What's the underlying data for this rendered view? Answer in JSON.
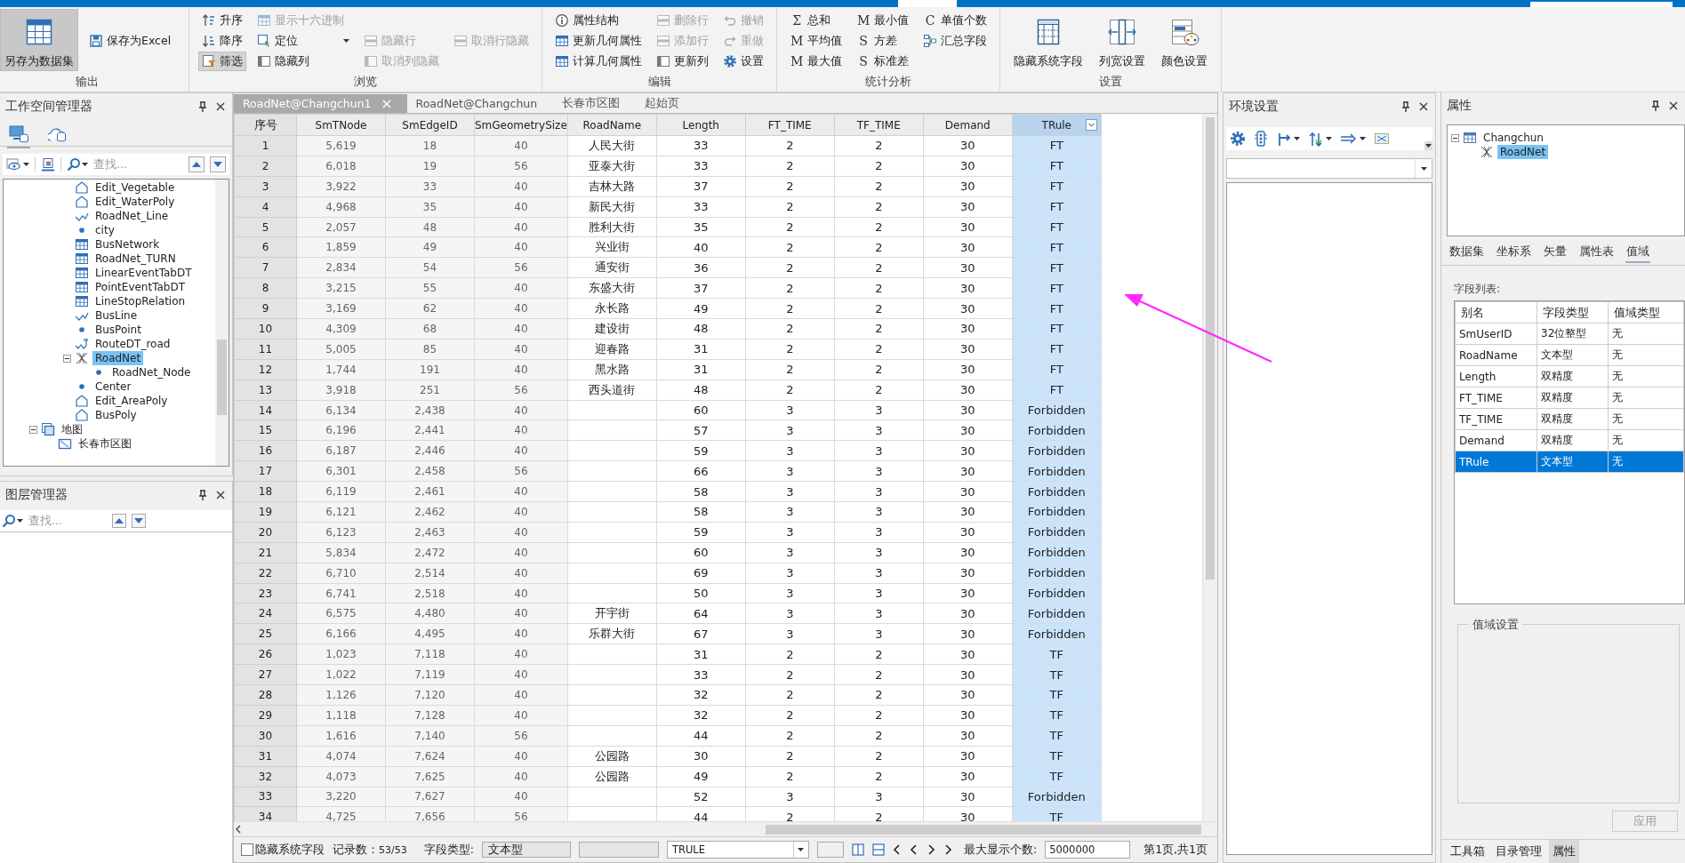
{
  "ribbon": {
    "groups": [
      {
        "label": "输出",
        "large": [
          {
            "label": "另存为数据集",
            "selected": true,
            "disabled": false
          }
        ],
        "rows": [
          [
            {
              "label": "保存为Excel",
              "kind": "plain",
              "selected": false,
              "disabled": false
            }
          ]
        ]
      },
      {
        "label": "浏览",
        "rows": [
          [
            {
              "label": "升序",
              "kind": "plain",
              "selected": false,
              "disabled": false
            },
            {
              "label": "显示十六进制",
              "kind": "plain",
              "selected": false,
              "disabled": true
            }
          ],
          [
            {
              "label": "降序",
              "kind": "plain",
              "selected": false,
              "disabled": false
            },
            {
              "label": "定位",
              "kind": "dropdown",
              "selected": false,
              "disabled": false
            },
            {
              "label": "隐藏行",
              "kind": "plain",
              "selected": false,
              "disabled": true
            },
            {
              "label": "取消行隐藏",
              "kind": "plain",
              "selected": false,
              "disabled": true
            }
          ],
          [
            {
              "label": "筛选",
              "kind": "plain",
              "selected": true,
              "disabled": false
            },
            {
              "label": "隐藏列",
              "kind": "plain",
              "selected": false,
              "disabled": false
            },
            {
              "label": "取消列隐藏",
              "kind": "plain",
              "selected": false,
              "disabled": true
            }
          ]
        ]
      },
      {
        "label": "编辑",
        "rows": [
          [
            {
              "label": "属性结构",
              "kind": "plain",
              "selected": false,
              "disabled": false
            },
            {
              "label": "删除行",
              "kind": "plain",
              "selected": false,
              "disabled": true
            },
            {
              "label": "撤销",
              "kind": "plain",
              "selected": false,
              "disabled": true
            }
          ],
          [
            {
              "label": "更新几何属性",
              "kind": "plain",
              "selected": false,
              "disabled": false
            },
            {
              "label": "添加行",
              "kind": "plain",
              "selected": false,
              "disabled": true
            },
            {
              "label": "重做",
              "kind": "plain",
              "selected": false,
              "disabled": true
            }
          ],
          [
            {
              "label": "计算几何属性",
              "kind": "plain",
              "selected": false,
              "disabled": false
            },
            {
              "label": "更新列",
              "kind": "plain",
              "selected": false,
              "disabled": false
            },
            {
              "label": "设置",
              "kind": "plain",
              "selected": false,
              "disabled": false
            }
          ]
        ]
      },
      {
        "label": "统计分析",
        "rows": [
          [
            {
              "label": "总和",
              "kind": "glyph",
              "glyph": "Σ",
              "selected": false,
              "disabled": false
            },
            {
              "label": "最小值",
              "kind": "glyph",
              "glyph": "M",
              "selected": false,
              "disabled": false
            },
            {
              "label": "单值个数",
              "kind": "glyph",
              "glyph": "C",
              "selected": false,
              "disabled": false
            }
          ],
          [
            {
              "label": "平均值",
              "kind": "glyph",
              "glyph": "M",
              "selected": false,
              "disabled": false
            },
            {
              "label": "方差",
              "kind": "glyph",
              "glyph": "S",
              "selected": false,
              "disabled": false
            },
            {
              "label": "汇总字段",
              "kind": "plain",
              "selected": false,
              "disabled": false
            }
          ],
          [
            {
              "label": "最大值",
              "kind": "glyph",
              "glyph": "M",
              "selected": false,
              "disabled": false
            },
            {
              "label": "标准差",
              "kind": "glyph",
              "glyph": "S",
              "selected": false,
              "disabled": false
            }
          ]
        ]
      },
      {
        "label": "设置",
        "large": [
          {
            "label": "隐藏系统字段",
            "selected": false,
            "disabled": false
          },
          {
            "label": "列宽设置",
            "selected": false,
            "disabled": false
          },
          {
            "label": "颜色设置",
            "selected": false,
            "disabled": false
          }
        ]
      }
    ]
  },
  "workspace": {
    "title": "工作空间管理器",
    "tabs": [
      {
        "selected": true
      },
      {
        "selected": false
      }
    ],
    "search_placeholder": "查找...",
    "datasets": [
      {
        "label": "Edit_Vegetable",
        "kind": "region",
        "selected": false
      },
      {
        "label": "Edit_WaterPoly",
        "kind": "region",
        "selected": false
      },
      {
        "label": "RoadNet_Line",
        "kind": "line",
        "selected": false
      },
      {
        "label": "city",
        "kind": "point",
        "selected": false
      },
      {
        "label": "BusNetwork",
        "kind": "tabular",
        "selected": false
      },
      {
        "label": "RoadNet_TURN",
        "kind": "tabular",
        "selected": false
      },
      {
        "label": "LinearEventTabDT",
        "kind": "tabular",
        "selected": false
      },
      {
        "label": "PointEventTabDT",
        "kind": "tabular",
        "selected": false
      },
      {
        "label": "LineStopRelation",
        "kind": "tabular",
        "selected": false
      },
      {
        "label": "BusLine",
        "kind": "line",
        "selected": false
      },
      {
        "label": "BusPoint",
        "kind": "point",
        "selected": false
      },
      {
        "label": "RouteDT_road",
        "kind": "route",
        "selected": false
      },
      {
        "label": "RoadNet",
        "kind": "network",
        "selected": true,
        "expanded": true,
        "children": [
          {
            "label": "RoadNet_Node",
            "kind": "point",
            "selected": false
          }
        ]
      },
      {
        "label": "Center",
        "kind": "point",
        "selected": false
      },
      {
        "label": "Edit_AreaPoly",
        "kind": "region",
        "selected": false
      },
      {
        "label": "BusPoly",
        "kind": "region",
        "selected": false
      }
    ],
    "maps": [
      {
        "label": "地图",
        "kind": "maps",
        "selected": false,
        "expanded": true,
        "children": [
          {
            "label": "长春市区图",
            "kind": "map",
            "selected": false
          }
        ]
      }
    ]
  },
  "layers": {
    "title": "图层管理器",
    "search_placeholder": "查找..."
  },
  "document": {
    "tabs": [
      {
        "label": "RoadNet@Changchun1",
        "selected": true,
        "closable": true
      },
      {
        "label": "RoadNet@Changchun",
        "selected": false,
        "closable": false
      },
      {
        "label": "长春市区图",
        "selected": false,
        "closable": false
      },
      {
        "label": "起始页",
        "selected": false,
        "closable": false
      }
    ],
    "table": {
      "columns": [
        {
          "label": "序号",
          "kind": "index",
          "selected": false
        },
        {
          "label": "SmTNode",
          "kind": "system",
          "selected": false
        },
        {
          "label": "SmEdgeID",
          "kind": "system",
          "selected": false
        },
        {
          "label": "SmGeometrySize",
          "kind": "system",
          "selected": false
        },
        {
          "label": "RoadName",
          "kind": "user",
          "selected": false
        },
        {
          "label": "Length",
          "kind": "user",
          "selected": false
        },
        {
          "label": "FT_TIME",
          "kind": "user",
          "selected": false
        },
        {
          "label": "TF_TIME",
          "kind": "user",
          "selected": false
        },
        {
          "label": "Demand",
          "kind": "user",
          "selected": false
        },
        {
          "label": "TRule",
          "kind": "user",
          "selected": true
        }
      ],
      "rows": [
        [
          "1",
          "5,619",
          "18",
          "40",
          "人民大街",
          "33",
          "2",
          "2",
          "30",
          "FT"
        ],
        [
          "2",
          "6,018",
          "19",
          "56",
          "亚泰大街",
          "33",
          "2",
          "2",
          "30",
          "FT"
        ],
        [
          "3",
          "3,922",
          "33",
          "40",
          "吉林大路",
          "37",
          "2",
          "2",
          "30",
          "FT"
        ],
        [
          "4",
          "4,968",
          "35",
          "40",
          "新民大街",
          "33",
          "2",
          "2",
          "30",
          "FT"
        ],
        [
          "5",
          "2,057",
          "48",
          "40",
          "胜利大街",
          "35",
          "2",
          "2",
          "30",
          "FT"
        ],
        [
          "6",
          "1,859",
          "49",
          "40",
          "兴业街",
          "40",
          "2",
          "2",
          "30",
          "FT"
        ],
        [
          "7",
          "2,834",
          "54",
          "56",
          "通安街",
          "36",
          "2",
          "2",
          "30",
          "FT"
        ],
        [
          "8",
          "3,215",
          "55",
          "40",
          "东盛大街",
          "37",
          "2",
          "2",
          "30",
          "FT"
        ],
        [
          "9",
          "3,169",
          "62",
          "40",
          "永长路",
          "49",
          "2",
          "2",
          "30",
          "FT"
        ],
        [
          "10",
          "4,309",
          "68",
          "40",
          "建设街",
          "48",
          "2",
          "2",
          "30",
          "FT"
        ],
        [
          "11",
          "5,005",
          "85",
          "40",
          "迎春路",
          "31",
          "2",
          "2",
          "30",
          "FT"
        ],
        [
          "12",
          "1,744",
          "191",
          "40",
          "黑水路",
          "31",
          "2",
          "2",
          "30",
          "FT"
        ],
        [
          "13",
          "3,918",
          "251",
          "56",
          "西头道街",
          "48",
          "2",
          "2",
          "30",
          "FT"
        ],
        [
          "14",
          "6,134",
          "2,438",
          "40",
          null,
          "60",
          "3",
          "3",
          "30",
          "Forbidden"
        ],
        [
          "15",
          "6,196",
          "2,441",
          "40",
          null,
          "57",
          "3",
          "3",
          "30",
          "Forbidden"
        ],
        [
          "16",
          "6,187",
          "2,446",
          "40",
          null,
          "59",
          "3",
          "3",
          "30",
          "Forbidden"
        ],
        [
          "17",
          "6,301",
          "2,458",
          "56",
          null,
          "66",
          "3",
          "3",
          "30",
          "Forbidden"
        ],
        [
          "18",
          "6,119",
          "2,461",
          "40",
          null,
          "58",
          "3",
          "3",
          "30",
          "Forbidden"
        ],
        [
          "19",
          "6,121",
          "2,462",
          "40",
          null,
          "58",
          "3",
          "3",
          "30",
          "Forbidden"
        ],
        [
          "20",
          "6,123",
          "2,463",
          "40",
          null,
          "59",
          "3",
          "3",
          "30",
          "Forbidden"
        ],
        [
          "21",
          "5,834",
          "2,472",
          "40",
          null,
          "60",
          "3",
          "3",
          "30",
          "Forbidden"
        ],
        [
          "22",
          "6,710",
          "2,514",
          "40",
          null,
          "69",
          "3",
          "3",
          "30",
          "Forbidden"
        ],
        [
          "23",
          "6,741",
          "2,518",
          "40",
          null,
          "50",
          "3",
          "3",
          "30",
          "Forbidden"
        ],
        [
          "24",
          "6,575",
          "4,480",
          "40",
          "开宇街",
          "64",
          "3",
          "3",
          "30",
          "Forbidden"
        ],
        [
          "25",
          "6,166",
          "4,495",
          "40",
          "乐群大街",
          "67",
          "3",
          "3",
          "30",
          "Forbidden"
        ],
        [
          "26",
          "1,023",
          "7,118",
          "40",
          null,
          "31",
          "2",
          "2",
          "30",
          "TF"
        ],
        [
          "27",
          "1,022",
          "7,119",
          "40",
          null,
          "33",
          "2",
          "2",
          "30",
          "TF"
        ],
        [
          "28",
          "1,126",
          "7,120",
          "40",
          null,
          "32",
          "2",
          "2",
          "30",
          "TF"
        ],
        [
          "29",
          "1,118",
          "7,128",
          "40",
          null,
          "32",
          "2",
          "2",
          "30",
          "TF"
        ],
        [
          "30",
          "1,616",
          "7,140",
          "56",
          null,
          "44",
          "2",
          "2",
          "30",
          "TF"
        ],
        [
          "31",
          "4,074",
          "7,624",
          "40",
          "公园路",
          "30",
          "2",
          "2",
          "30",
          "TF"
        ],
        [
          "32",
          "4,073",
          "7,625",
          "40",
          "公园路",
          "49",
          "2",
          "2",
          "30",
          "TF"
        ],
        [
          "33",
          "3,220",
          "7,627",
          "40",
          null,
          "52",
          "3",
          "3",
          "30",
          "Forbidden"
        ],
        [
          "34",
          "4,725",
          "7,656",
          "56",
          null,
          "44",
          "2",
          "2",
          "30",
          "TF"
        ]
      ]
    },
    "status_bar": {
      "hide_system_fields": {
        "label": "隐藏系统字段",
        "checked": false
      },
      "record_label": "记录数：",
      "record_count": "53/53",
      "field_type_label": "字段类型:",
      "field_type_value": "文本型",
      "field_name_value": "TRULE",
      "max_label": "最大显示个数:",
      "max_value": "5000000",
      "page_info": "第1页,共1页"
    }
  },
  "environment": {
    "title": "环境设置"
  },
  "properties": {
    "title": "属性",
    "tree": [
      {
        "label": "Changchun",
        "kind": "datasource",
        "selected": false,
        "expanded": true,
        "children": [
          {
            "label": "RoadNet",
            "kind": "network",
            "selected": true
          }
        ]
      }
    ],
    "tabs": [
      {
        "label": "数据集",
        "selected": false
      },
      {
        "label": "坐标系",
        "selected": false
      },
      {
        "label": "矢量",
        "selected": false
      },
      {
        "label": "属性表",
        "selected": false
      },
      {
        "label": "值域",
        "selected": true
      }
    ],
    "field_list_label": "字段列表:",
    "field_table": {
      "columns": [
        "别名",
        "字段类型",
        "值域类型"
      ],
      "rows": [
        {
          "cells": [
            "SmUserID",
            "32位整型",
            "无"
          ],
          "selected": false
        },
        {
          "cells": [
            "RoadName",
            "文本型",
            "无"
          ],
          "selected": false
        },
        {
          "cells": [
            "Length",
            "双精度",
            "无"
          ],
          "selected": false
        },
        {
          "cells": [
            "FT_TIME",
            "双精度",
            "无"
          ],
          "selected": false
        },
        {
          "cells": [
            "TF_TIME",
            "双精度",
            "无"
          ],
          "selected": false
        },
        {
          "cells": [
            "Demand",
            "双精度",
            "无"
          ],
          "selected": false
        },
        {
          "cells": [
            "TRule",
            "文本型",
            "无"
          ],
          "selected": true
        }
      ]
    },
    "domain_group": "值域设置",
    "apply_button": {
      "label": "应用",
      "disabled": true
    },
    "bottom_tabs": [
      {
        "label": "工具箱",
        "selected": false
      },
      {
        "label": "目录管理",
        "selected": false
      },
      {
        "label": "属性",
        "selected": true
      }
    ]
  }
}
